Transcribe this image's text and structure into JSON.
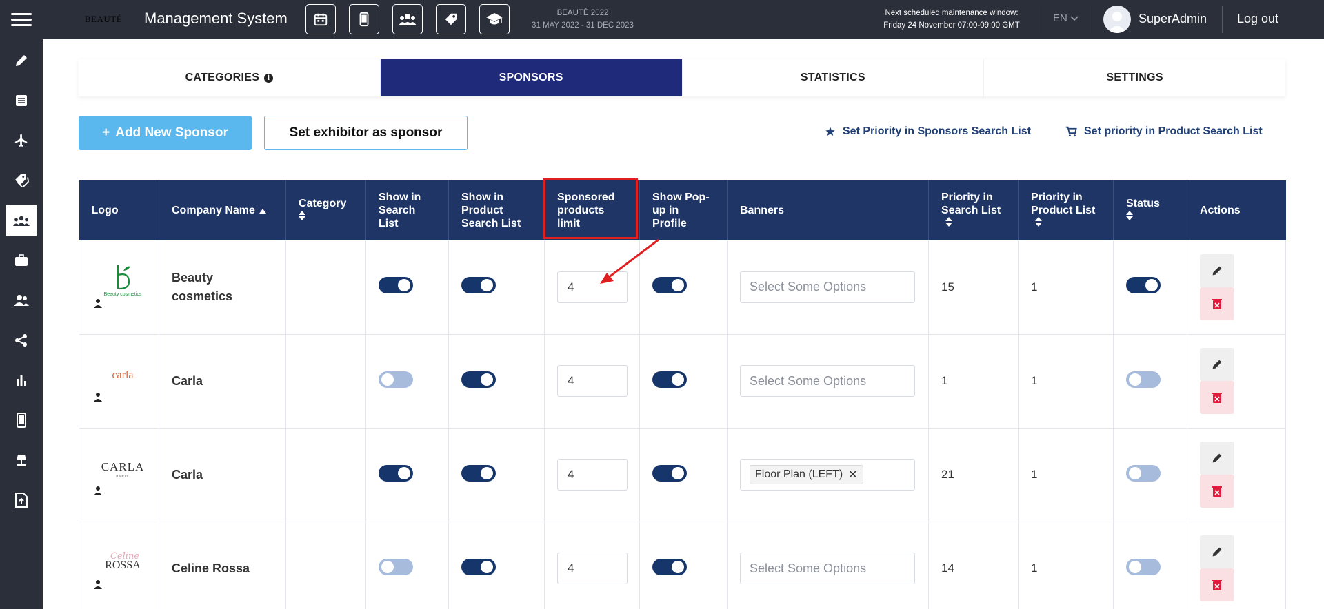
{
  "header": {
    "logo_text": "BEAUTÉ",
    "app_title": "Management System",
    "event_name": "BEAUTÉ 2022",
    "event_dates": "31 MAY 2022 - 31 DEC 2023",
    "maintenance_title": "Next scheduled maintenance window:",
    "maintenance_time": "Friday 24 November 07:00-09:00 GMT",
    "language": "EN",
    "user_name": "SuperAdmin",
    "logout_label": "Log out",
    "icons": [
      "calendar-icon",
      "mobile-icon",
      "users-icon",
      "tag-icon",
      "graduation-cap-icon"
    ]
  },
  "sidebar": {
    "items": [
      {
        "icon": "pencil-icon",
        "active": false
      },
      {
        "icon": "list-icon",
        "active": false
      },
      {
        "icon": "plane-icon",
        "active": false
      },
      {
        "icon": "tags-icon",
        "active": false
      },
      {
        "icon": "sponsors-group-icon",
        "active": true
      },
      {
        "icon": "briefcase-icon",
        "active": false
      },
      {
        "icon": "users-icon",
        "active": false
      },
      {
        "icon": "share-icon",
        "active": false
      },
      {
        "icon": "bar-chart-icon",
        "active": false
      },
      {
        "icon": "mobile-icon",
        "active": false
      },
      {
        "icon": "lamp-icon",
        "active": false
      },
      {
        "icon": "file-upload-icon",
        "active": false
      }
    ]
  },
  "tabs": [
    {
      "label": "CATEGORIES",
      "active": false,
      "info": true
    },
    {
      "label": "SPONSORS",
      "active": true,
      "info": false
    },
    {
      "label": "STATISTICS",
      "active": false,
      "info": false
    },
    {
      "label": "SETTINGS",
      "active": false,
      "info": false
    }
  ],
  "actions": {
    "add_label": "Add New Sponsor",
    "set_exhibitor_label": "Set exhibitor as sponsor",
    "priority_sponsors_label": "Set Priority in Sponsors Search List",
    "priority_products_label": "Set priority in Product Search List"
  },
  "table": {
    "columns": {
      "logo": "Logo",
      "company": "Company Name",
      "category": "Category",
      "show_search": "Show in Search List",
      "show_product_search": "Show in Product Search List",
      "sponsored_limit": "Sponsored products limit",
      "show_popup": "Show Pop-up in Profile",
      "banners": "Banners",
      "priority_search": "Priority in Search List",
      "priority_product": "Priority in Product List",
      "status": "Status",
      "actions": "Actions"
    },
    "select_placeholder": "Select Some Options",
    "rows": [
      {
        "company": "Beauty cosmetics",
        "logo_text": "Beauty cosmetics",
        "category": "",
        "show_search": true,
        "show_product_search": true,
        "limit": "4",
        "show_popup": true,
        "banners": [],
        "priority_search": "15",
        "priority_product": "1",
        "status": true
      },
      {
        "company": "Carla",
        "logo_text": "carla",
        "category": "",
        "show_search": false,
        "show_product_search": true,
        "limit": "4",
        "show_popup": true,
        "banners": [],
        "priority_search": "1",
        "priority_product": "1",
        "status": false
      },
      {
        "company": "Carla",
        "logo_text": "CARLA",
        "logo_sub": "PARIS",
        "category": "",
        "show_search": true,
        "show_product_search": true,
        "limit": "4",
        "show_popup": true,
        "banners": [
          "Floor Plan (LEFT)"
        ],
        "priority_search": "21",
        "priority_product": "1",
        "status": false
      },
      {
        "company": "Celine Rossa",
        "logo_text": "ROSSA",
        "logo_script": "Celine",
        "category": "",
        "show_search": false,
        "show_product_search": true,
        "limit": "4",
        "show_popup": true,
        "banners": [],
        "priority_search": "14",
        "priority_product": "1",
        "status": false
      }
    ]
  },
  "colors": {
    "header_bg": "#2b2f3a",
    "tab_active": "#1f2a7a",
    "table_head": "#1f3565",
    "add_button": "#5bb8ee",
    "toggle_on": "#16366b",
    "toggle_off": "#a7bcdc",
    "annotation": "#e02020"
  }
}
